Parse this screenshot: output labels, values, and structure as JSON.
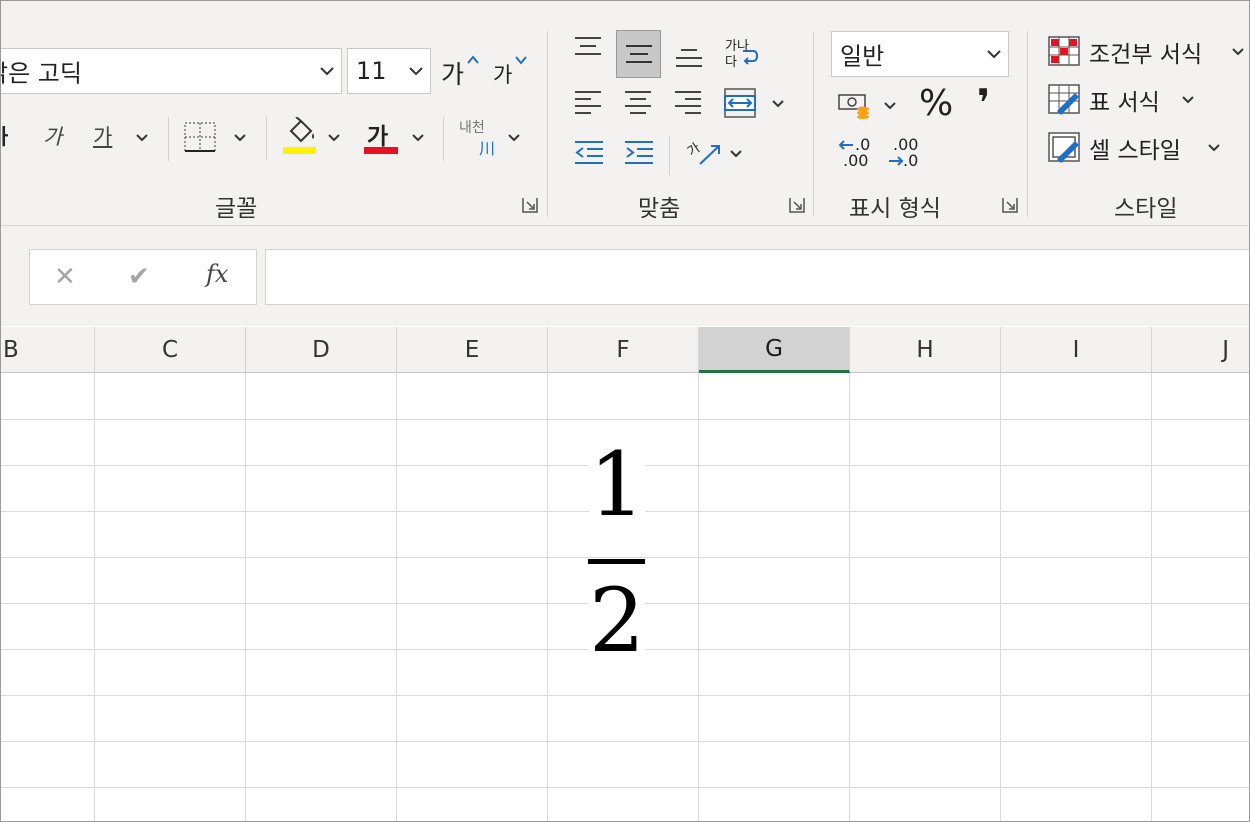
{
  "ribbon": {
    "font": {
      "name": "맑은 고딕",
      "size": "11",
      "increase_label": "가",
      "decrease_label": "가",
      "italic_label": "가",
      "underline_label": "가",
      "font_color_label": "가",
      "phonetic_top": "내천",
      "phonetic_bottom": "川",
      "group_label": "글꼴",
      "fill_color": "#FFF200",
      "font_color": "#E81123"
    },
    "alignment": {
      "wrap_top": "가나",
      "wrap_bottom": "다",
      "orientation_label": "가",
      "group_label": "맞춤"
    },
    "number": {
      "format": "일반",
      "percent_label": "%",
      "comma_label": "❜",
      "inc_decimal_top": ".0",
      "inc_decimal_bottom": ".00",
      "dec_decimal_top": ".00",
      "dec_decimal_bottom": ".0",
      "group_label": "표시 형식"
    },
    "styles": {
      "conditional": "조건부 서식",
      "table": "표 서식",
      "cell": "셀 스타일",
      "group_label": "스타일"
    }
  },
  "formula_bar": {
    "cancel": "✕",
    "enter": "✔",
    "fx": "fx",
    "value": ""
  },
  "columns": [
    "B",
    "C",
    "D",
    "E",
    "F",
    "G",
    "H",
    "I",
    "J"
  ],
  "selected_column": "G",
  "cell_content": {
    "numerator": "1",
    "denominator": "2"
  }
}
